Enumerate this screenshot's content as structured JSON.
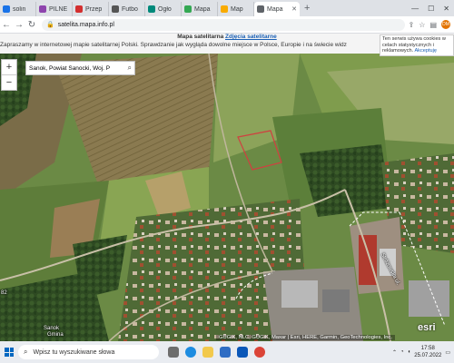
{
  "tabs": [
    {
      "label": "solin",
      "color": "#1a73e8"
    },
    {
      "label": "PILNE",
      "color": "#8e44ad"
    },
    {
      "label": "Przep",
      "color": "#d32f2f"
    },
    {
      "label": "Futbo",
      "color": "#555555"
    },
    {
      "label": "Ogło",
      "color": "#00897b"
    },
    {
      "label": "Mapa",
      "color": "#34a853"
    },
    {
      "label": "Map",
      "color": "#f9ab00"
    },
    {
      "label": "Mapa",
      "color": "#5f6368",
      "active": true
    }
  ],
  "window_controls": {
    "minimize": "—",
    "maximize": "☐",
    "close": "✕"
  },
  "address": {
    "url": "satelita.mapa.info.pl"
  },
  "profile": {
    "initials": "DM"
  },
  "banner": {
    "title": "Mapa satelitarna",
    "link": "Zdjęcia satelitarne",
    "description": "Zapraszamy w internetowej mapie satelitarnej Polski. Sprawdzanie jak wygląda dowolne miejsce w Polsce, Europie i na świecie widz"
  },
  "cookie": {
    "text": "Ten serwis używa cookies w celach statystycznych i reklamowych.",
    "accept": "Akceptuję"
  },
  "map": {
    "search_value": "Sanok, Powiat Sanocki, Woj. P",
    "zoom_in": "+",
    "zoom_out": "−",
    "labels": {
      "town": "Sanok",
      "gmina": "Gmina",
      "street": "Stróżowska ul.",
      "number": "82"
    },
    "attribution": "GUGiK, NLC, GUGiK, Maxar | Esri, HERE, Garmin, GeoTechnologies, Inc.",
    "logo": "esri"
  },
  "taskbar": {
    "search_placeholder": "Wpisz tu wyszukiwane słowa",
    "time": "17:58",
    "date": "25.07.2022"
  }
}
